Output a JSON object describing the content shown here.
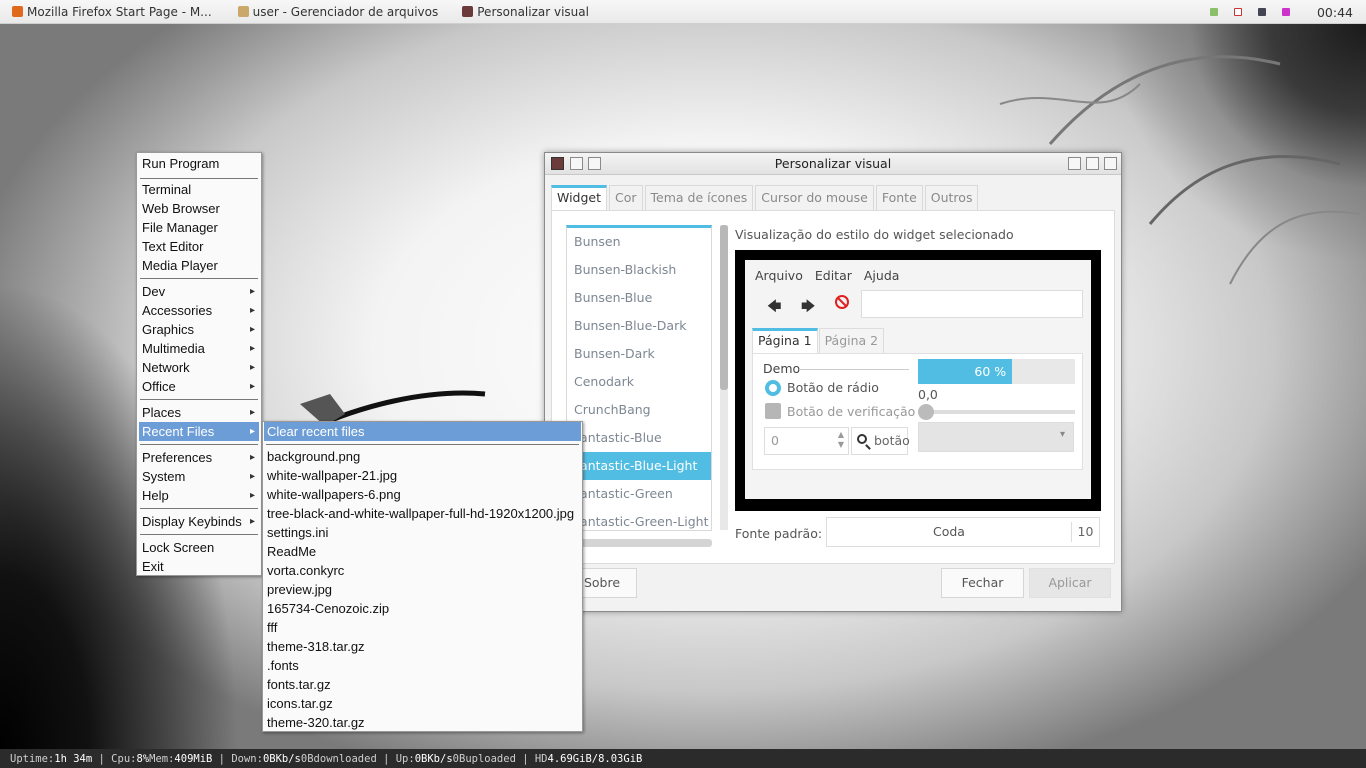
{
  "taskbar": {
    "tasks": [
      "Mozilla Firefox Start Page - M...",
      "user - Gerenciador de arquivos",
      "Personalizar visual"
    ],
    "clock": "00:44"
  },
  "conky": {
    "uptime_label": "Uptime:",
    "uptime": "1h 34m",
    "cpu_label": "Cpu:",
    "cpu": "8%",
    "mem_label": "Mem:",
    "mem": "409MiB",
    "down_label": "Down:",
    "down": "0B",
    "kbs1": "Kb/s",
    "downloaded": "0B",
    "downloaded_label": "downloaded",
    "up_label": "Up:",
    "up": "0B",
    "kbs2": "Kb/s",
    "uploaded": "0B",
    "uploaded_label": "uploaded",
    "hd_label": "HD",
    "hd": "4.69GiB/8.03GiB"
  },
  "menu": {
    "items": [
      "Run Program",
      "Terminal",
      "Web Browser",
      "File Manager",
      "Text Editor",
      "Media Player",
      "Dev",
      "Accessories",
      "Graphics",
      "Multimedia",
      "Network",
      "Office",
      "Places",
      "Recent Files",
      "Preferences",
      "System",
      "Help",
      "Display Keybinds",
      "Lock Screen",
      "Exit"
    ]
  },
  "recent": {
    "clear": "Clear recent files",
    "files": [
      "background.png",
      "white-wallpaper-21.jpg",
      "white-wallpapers-6.png",
      "tree-black-and-white-wallpaper-full-hd-1920x1200.jpg",
      "settings.ini",
      "ReadMe",
      "vorta.conkyrc",
      "preview.jpg",
      "165734-Cenozoic.zip",
      "fff",
      "theme-318.tar.gz",
      ".fonts",
      "fonts.tar.gz",
      "icons.tar.gz",
      "theme-320.tar.gz"
    ]
  },
  "window": {
    "title": "Personalizar visual",
    "tabs": [
      "Widget",
      "Cor",
      "Tema de ícones",
      "Cursor do mouse",
      "Fonte",
      "Outros"
    ],
    "themes": [
      "Bunsen",
      "Bunsen-Blackish",
      "Bunsen-Blue",
      "Bunsen-Blue-Dark",
      "Bunsen-Dark",
      "Cenodark",
      "CrunchBang",
      "Fantastic-Blue",
      "Fantastic-Blue-Light",
      "Fantastic-Green",
      "Fantastic-Green-Light"
    ],
    "preview_label": "Visualização do estilo do widget selecionado",
    "preview": {
      "menu": [
        "Arquivo",
        "Editar",
        "Ajuda"
      ],
      "tabs": [
        "Página 1",
        "Página 2"
      ],
      "demo": "Demo",
      "radio": "Botão de rádio",
      "check": "Botão de verificação",
      "progress": 0.6,
      "progress_text": "60 %",
      "value": "0,0",
      "spin": "0",
      "button": "botão"
    },
    "font_label": "Fonte padrão:",
    "font_name": "Coda",
    "font_size": "10",
    "about": "Sobre",
    "close": "Fechar",
    "apply": "Aplicar"
  }
}
